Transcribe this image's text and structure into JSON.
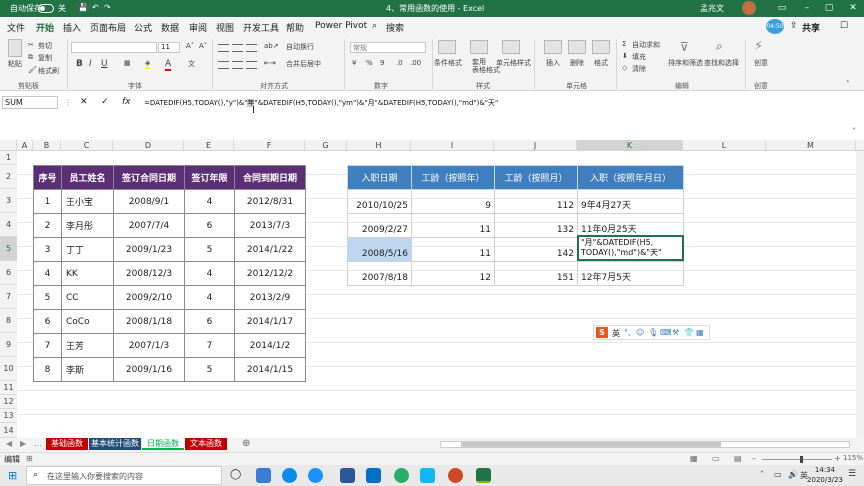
{
  "title_bar": {
    "autosave_label": "自动保存",
    "autosave_state": "关",
    "doc_title": "4、常用函数的使用 - Excel",
    "user_name": "孟兆文",
    "avatar_text": "04:50"
  },
  "menu": {
    "items": [
      "文件",
      "开始",
      "插入",
      "页面布局",
      "公式",
      "数据",
      "审阅",
      "视图",
      "开发工具",
      "帮助",
      "Power Pivot"
    ],
    "active": "开始",
    "search": "搜索",
    "share": "共享"
  },
  "ribbon": {
    "paste": "粘贴",
    "cut": "剪切",
    "copy": "复制",
    "format_painter": "格式刷",
    "font_size": "11",
    "font_bold": "B",
    "font_italic": "I",
    "font_underline": "U",
    "wrap_text": "自动换行",
    "merge_center": "合并后居中",
    "number_format": "常规",
    "cond_format": "条件格式",
    "table_format": "套用\n表格格式",
    "cell_style": "单元格样式",
    "insert": "插入",
    "delete": "删除",
    "format": "格式",
    "autosum": "自动求和",
    "fill": "填充",
    "clear": "清除",
    "sort_filter": "排序和筛选",
    "find_select": "查找和选择",
    "ideas": "创意",
    "groups": [
      "剪贴板",
      "字体",
      "对齐方式",
      "数字",
      "样式",
      "单元格",
      "编辑",
      "创意"
    ]
  },
  "formula_bar": {
    "name_box": "SUM",
    "formula_before": "=DATEDIF(H5,TODAY(),\"y\")&\"",
    "formula_highlight": "年",
    "formula_after": "\"&DATEDIF(H5,TODAY(),\"ym\")&\"月\"&DATEDIF(H5,TODAY(),\"md\")&\"天\""
  },
  "columns": [
    "A",
    "B",
    "C",
    "D",
    "E",
    "F",
    "G",
    "H",
    "I",
    "J",
    "K",
    "L",
    "M"
  ],
  "rows": [
    "1",
    "2",
    "3",
    "4",
    "5",
    "6",
    "7",
    "8",
    "9",
    "10",
    "11",
    "12",
    "13",
    "14"
  ],
  "table1": {
    "headers": [
      "序号",
      "员工姓名",
      "签订合同日期",
      "签订年限",
      "合同到期日期"
    ],
    "rows": [
      [
        "1",
        "王小宝",
        "2008/9/1",
        "4",
        "2012/8/31"
      ],
      [
        "2",
        "李月彤",
        "2007/7/4",
        "6",
        "2013/7/3"
      ],
      [
        "3",
        "丁丁",
        "2009/1/23",
        "5",
        "2014/1/22"
      ],
      [
        "4",
        "KK",
        "2008/12/3",
        "4",
        "2012/12/2"
      ],
      [
        "5",
        "CC",
        "2009/2/10",
        "4",
        "2013/2/9"
      ],
      [
        "6",
        "CoCo",
        "2008/1/18",
        "6",
        "2014/1/17"
      ],
      [
        "7",
        "王芳",
        "2007/1/3",
        "7",
        "2014/1/2"
      ],
      [
        "8",
        "李斯",
        "2009/1/16",
        "5",
        "2014/1/15"
      ]
    ]
  },
  "table2": {
    "headers": [
      "入职日期",
      "工龄（按照年）",
      "工龄（按照月）",
      "入职（按照年月日）"
    ],
    "rows": [
      [
        "2010/10/25",
        "9",
        "112",
        "9年4月27天"
      ],
      [
        "2009/2/27",
        "11",
        "132",
        "11年0月25天"
      ],
      [
        "2008/5/16",
        "11",
        "142",
        ""
      ],
      [
        "2007/8/18",
        "12",
        "151",
        "12年7月5天"
      ]
    ],
    "editing_text_1": "\"月\"&DATEDIF(H5,",
    "editing_text_2": "TODAY(),\"md\")&\"天\""
  },
  "ime": {
    "logo": "S",
    "lang": "英"
  },
  "sheet_tabs": [
    {
      "label": "基础函数",
      "color": "#c00000"
    },
    {
      "label": "基本统计函数",
      "color": "#1f4e79"
    },
    {
      "label": "日期函数",
      "color": "#00b050"
    },
    {
      "label": "文本函数",
      "color": "#c00000"
    }
  ],
  "status": {
    "mode": "编辑",
    "zoom": "115%"
  },
  "taskbar": {
    "search_placeholder": "在这里输入你要搜索的内容",
    "time": "14:34",
    "date": "2020/3/23"
  }
}
